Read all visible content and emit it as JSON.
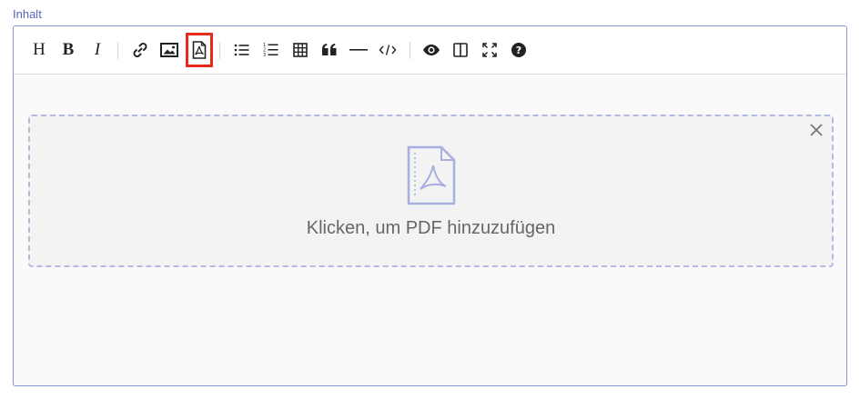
{
  "field": {
    "label": "Inhalt"
  },
  "toolbar": {
    "heading_label": "H",
    "bold_label": "B",
    "italic_label": "I",
    "icons": [
      "link-icon",
      "image-icon",
      "pdf-icon",
      "unordered-list-icon",
      "ordered-list-icon",
      "table-icon",
      "quote-icon",
      "horizontal-rule-icon",
      "code-icon",
      "preview-icon",
      "side-by-side-icon",
      "fullscreen-icon",
      "help-icon"
    ],
    "highlight_color": "#e8281a"
  },
  "dropzone": {
    "text": "Klicken, um PDF hinzuzufügen",
    "icon": "pdf-file-icon",
    "close_icon": "close-icon",
    "border_color": "#b4b9e4"
  },
  "colors": {
    "accent": "#5566bb",
    "editor_border": "#8893d6"
  }
}
